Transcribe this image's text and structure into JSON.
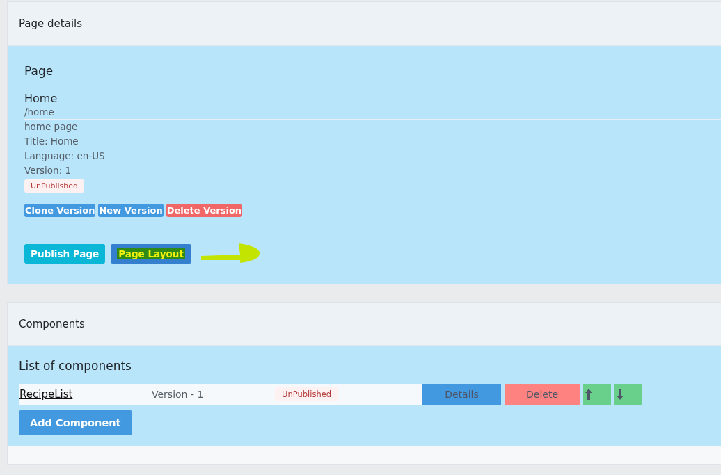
{
  "page_details": {
    "header": "Page details",
    "heading": "Page",
    "name": "Home",
    "path": "/home",
    "lines": [
      "home page",
      "Title: Home",
      "Language: en-US",
      "Version: 1"
    ],
    "status": "UnPublished",
    "version_buttons": [
      {
        "label": "Clone Version",
        "kind": "primary"
      },
      {
        "label": "New Version",
        "kind": "primary"
      },
      {
        "label": "Delete Version",
        "kind": "danger"
      }
    ],
    "action_buttons": [
      {
        "label": "Publish Page",
        "kind": "info",
        "highlighted": false
      },
      {
        "label": "Page Layout",
        "kind": "primary",
        "highlighted": true
      }
    ]
  },
  "components": {
    "header": "Components",
    "heading": "List of components",
    "rows": [
      {
        "name": "RecipeList",
        "version": "Version - 1",
        "status": "UnPublished",
        "details": "Details",
        "delete": "Delete"
      }
    ],
    "add_button": "Add Component"
  }
}
